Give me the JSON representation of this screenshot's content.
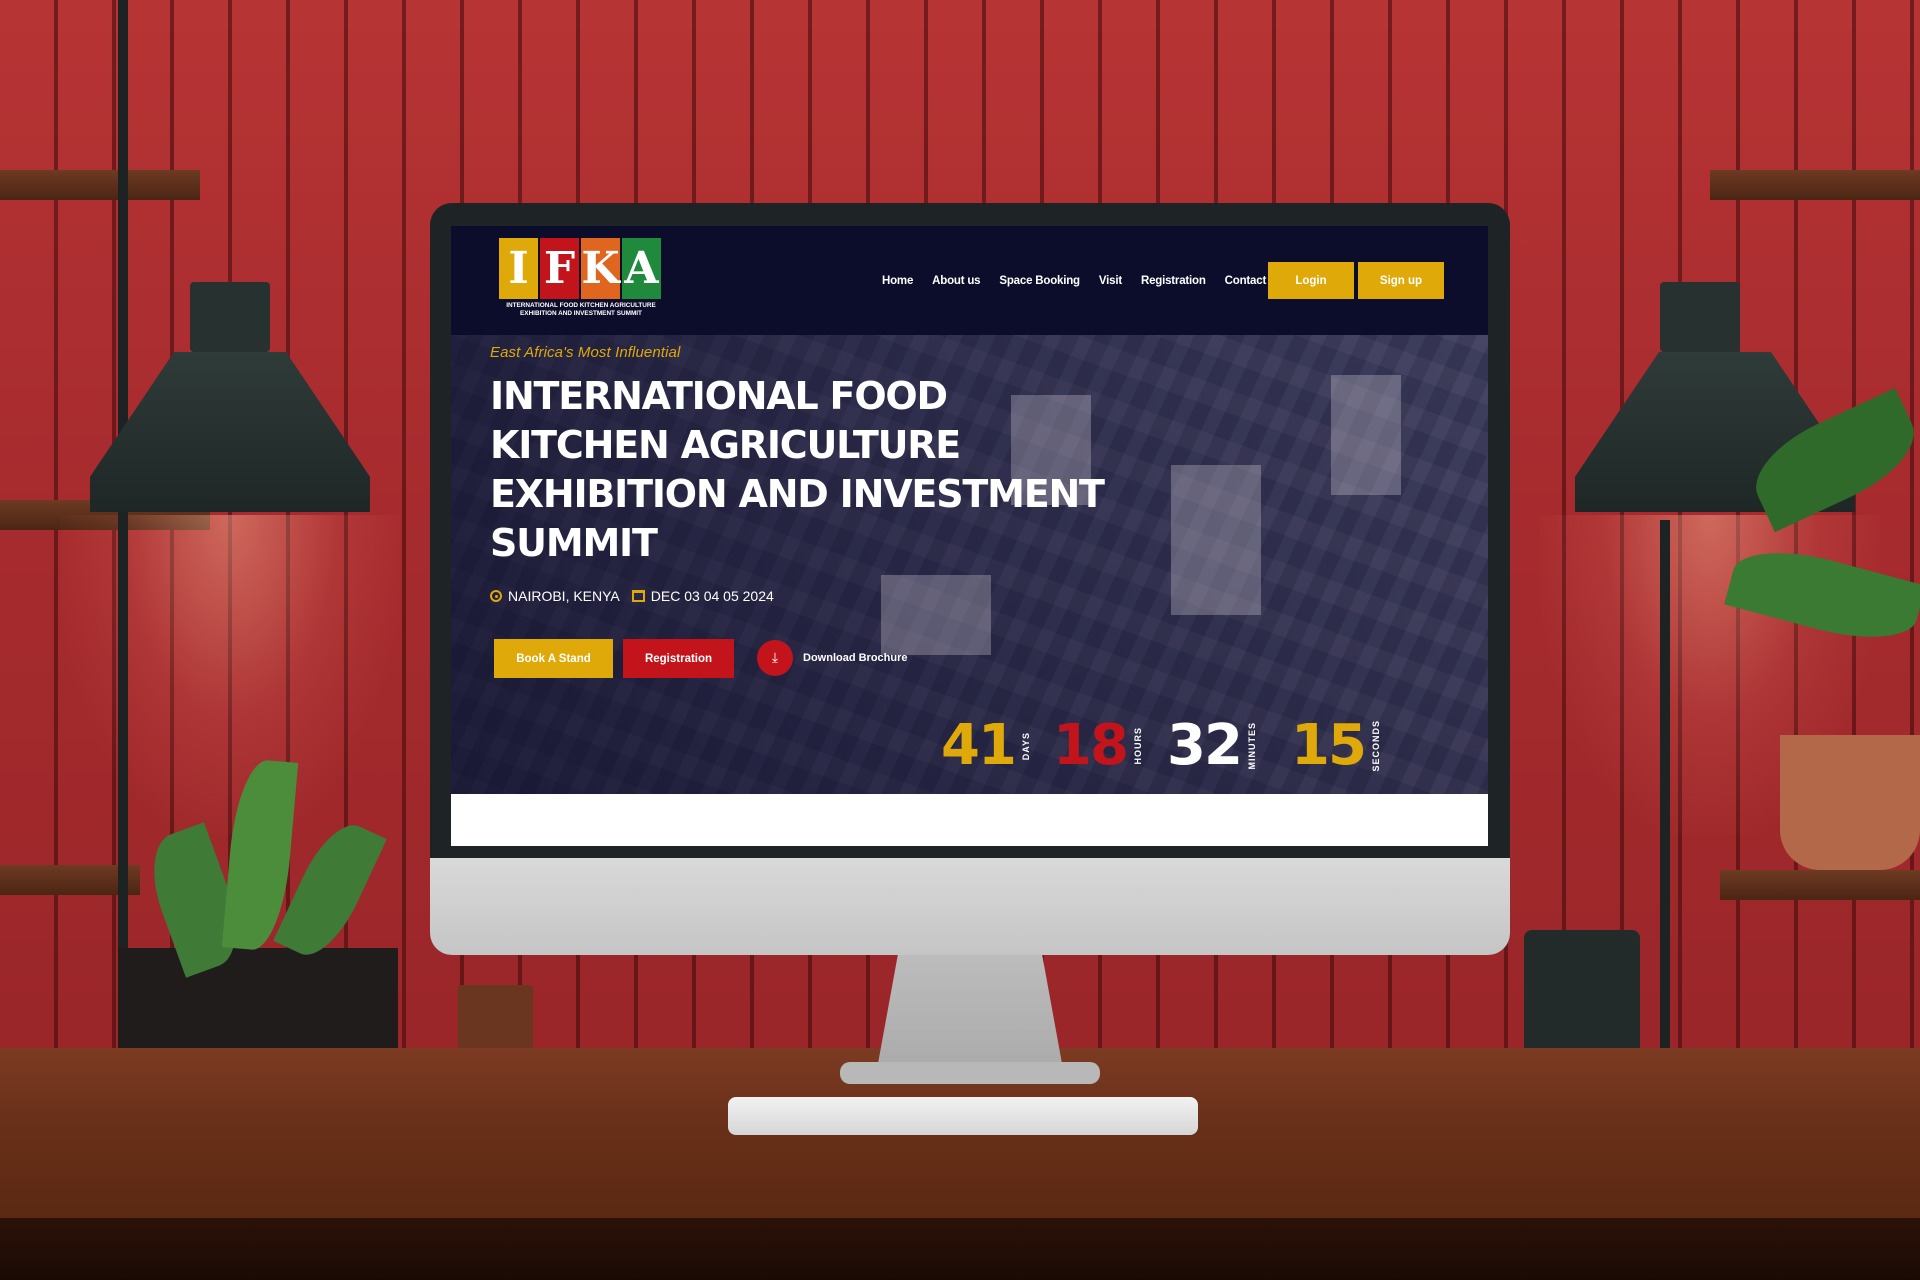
{
  "brand": {
    "letters": [
      "I",
      "F",
      "K",
      "A"
    ],
    "letter_colors": [
      "#e0a90a",
      "#c4141b",
      "#e0661f",
      "#1f8a3b"
    ],
    "subtitle_line1": "INTERNATIONAL FOOD KITCHEN AGRICULTURE",
    "subtitle_line2": "EXHIBITION AND INVESTMENT SUMMIT"
  },
  "nav": {
    "items": [
      "Home",
      "About us",
      "Space Booking",
      "Visit",
      "Registration",
      "Contact us"
    ],
    "login_label": "Login",
    "signup_label": "Sign up"
  },
  "hero": {
    "tagline": "East Africa's Most Influential",
    "title": "INTERNATIONAL FOOD KITCHEN AGRICULTURE EXHIBITION AND INVESTMENT SUMMIT",
    "location": "NAIROBI, KENYA",
    "dates": "DEC 03 04 05 2024",
    "book_stand_label": "Book A Stand",
    "registration_label": "Registration",
    "download_label": "Download Brochure"
  },
  "countdown": {
    "days": "41",
    "days_label": "DAYS",
    "hours": "18",
    "hours_label": "HOURS",
    "minutes": "32",
    "minutes_label": "MINUTES",
    "seconds": "15",
    "seconds_label": "SECONDS"
  },
  "colors": {
    "header_bg": "#0c0d2b",
    "accent_gold": "#e0a90a",
    "accent_red": "#c4141b",
    "minutes_color": "#ffffff"
  },
  "icons": {
    "location": "location-pin-icon",
    "calendar": "calendar-icon",
    "download": "download-icon"
  }
}
